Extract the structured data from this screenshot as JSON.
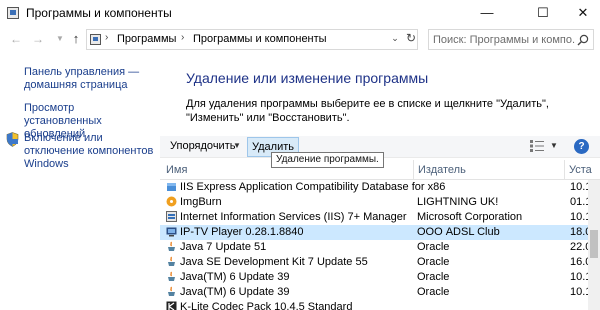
{
  "window": {
    "title": "Программы и компоненты",
    "minimize": "—",
    "maximize": "☐",
    "close": "✕"
  },
  "address": {
    "crumbs": [
      "Программы",
      "Программы и компоненты"
    ],
    "search_placeholder": "Поиск: Программы и компо..."
  },
  "left_pane": {
    "links": [
      "Панель управления — домашняя страница",
      "Просмотр установленных обновлений",
      "Включение или отключение компонентов Windows"
    ]
  },
  "main": {
    "title": "Удаление или изменение программы",
    "description": "Для удаления программы выберите ее в списке и щелкните \"Удалить\", \"Изменить\" или \"Восстановить\"."
  },
  "toolbar": {
    "organize_label": "Упорядочить",
    "uninstall_label": "Удалить",
    "help_label": "?",
    "tooltip": "Удаление программы."
  },
  "columns": {
    "name": "Имя",
    "publisher": "Издатель",
    "installed": "Уста"
  },
  "rows": [
    {
      "name": "IIS Express Application Compatibility Database for x86",
      "publisher": "",
      "installed": "10.1",
      "icon": "package-icon",
      "selected": false
    },
    {
      "name": "ImgBurn",
      "publisher": "LIGHTNING UK!",
      "installed": "01.1",
      "icon": "imgburn-icon",
      "selected": false
    },
    {
      "name": "Internet Information Services (IIS) 7+ Manager",
      "publisher": "Microsoft Corporation",
      "installed": "10.1",
      "icon": "iis-icon",
      "selected": false
    },
    {
      "name": "IP-TV Player 0.28.1.8840",
      "publisher": "ООО ADSL Club",
      "installed": "18.0",
      "icon": "iptv-icon",
      "selected": true
    },
    {
      "name": "Java 7 Update 51",
      "publisher": "Oracle",
      "installed": "22.0",
      "icon": "java-icon",
      "selected": false
    },
    {
      "name": "Java SE Development Kit 7 Update 55",
      "publisher": "Oracle",
      "installed": "16.0",
      "icon": "java-icon",
      "selected": false
    },
    {
      "name": "Java(TM) 6 Update 39",
      "publisher": "Oracle",
      "installed": "10.1",
      "icon": "java-icon",
      "selected": false
    },
    {
      "name": "Java(TM) 6 Update 39",
      "publisher": "Oracle",
      "installed": "10.1",
      "icon": "java-icon",
      "selected": false
    },
    {
      "name": "K-Lite Codec Pack 10.4.5 Standard",
      "publisher": "",
      "installed": "",
      "icon": "klite-icon",
      "selected": false
    }
  ],
  "colors": {
    "link": "#1a3e8c",
    "heading": "#1e3287",
    "selection": "#cce8ff"
  }
}
